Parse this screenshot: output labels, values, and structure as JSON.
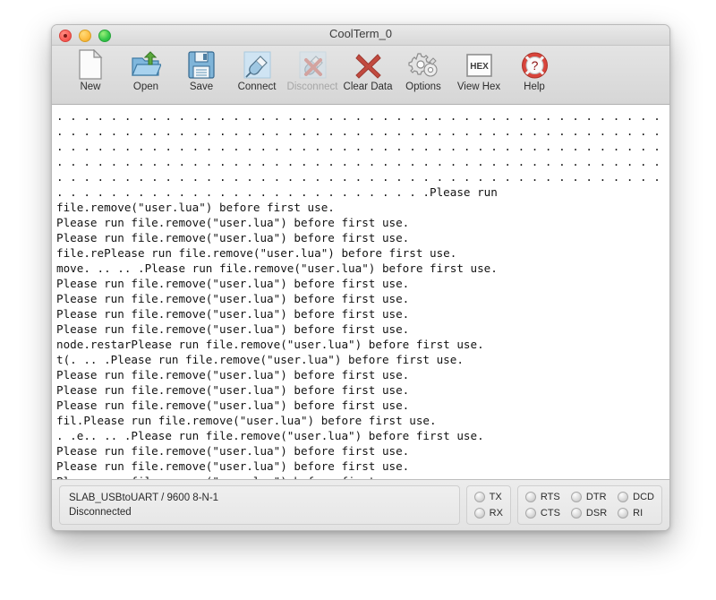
{
  "window": {
    "title": "CoolTerm_0",
    "traffic_lights": [
      "close-button",
      "minimize-button",
      "zoom-button"
    ]
  },
  "toolbar": {
    "items": [
      {
        "label": "New",
        "icon": "new-document-icon",
        "disabled": false
      },
      {
        "label": "Open",
        "icon": "open-folder-icon",
        "disabled": false
      },
      {
        "label": "Save",
        "icon": "save-floppy-icon",
        "disabled": false
      },
      {
        "label": "Connect",
        "icon": "connect-plug-icon",
        "disabled": false
      },
      {
        "label": "Disconnect",
        "icon": "disconnect-plug-icon",
        "disabled": true
      },
      {
        "label": "Clear Data",
        "icon": "clear-x-icon",
        "disabled": false
      },
      {
        "label": "Options",
        "icon": "gears-options-icon",
        "disabled": false
      },
      {
        "label": "View Hex",
        "icon": "hex-icon",
        "disabled": false,
        "icon_text": "HEX"
      },
      {
        "label": "Help",
        "icon": "help-lifering-icon",
        "disabled": false
      }
    ]
  },
  "terminal": {
    "lines": [
      ". . . . . . . . . . . . . . . . . . . . . . . . . . . . . . . . . . . . . . . . . . . . . . . . . . . . . . . . . . . . .",
      ". . . . . . . . . . . . . . . . . . . . . . . . . . . . . . . . . . . . . . . . . . . . . . . . . . . . . . . . . . . . .",
      ". . . . . . . . . . . . . . . . . . . . . . . . . . . . . . . . . . . . . . . . . . . . . . . . . . . . . . . . . . . . .",
      ". . . . . . . . . . . . . . . . . . . . . . . . . . . . . . . . . . . . . . . . . . . . . . . . . . . . . . . . . . . . .",
      ". . . . . . . . . . . . . . . . . . . . . . . . . . . . . . . . . . . . . . . . . . . . . . . . . . . . . . . . . . . . .",
      ". . . . . . . . . . . . . . . . . . . . . . . . . . . .Please run",
      "file.remove(\"user.lua\") before first use.",
      "Please run file.remove(\"user.lua\") before first use.",
      "Please run file.remove(\"user.lua\") before first use.",
      "file.rePlease run file.remove(\"user.lua\") before first use.",
      "move. .. .. .Please run file.remove(\"user.lua\") before first use.",
      "Please run file.remove(\"user.lua\") before first use.",
      "Please run file.remove(\"user.lua\") before first use.",
      "Please run file.remove(\"user.lua\") before first use.",
      "Please run file.remove(\"user.lua\") before first use.",
      "node.restarPlease run file.remove(\"user.lua\") before first use.",
      "t(. .. .Please run file.remove(\"user.lua\") before first use.",
      "Please run file.remove(\"user.lua\") before first use.",
      "Please run file.remove(\"user.lua\") before first use.",
      "Please run file.remove(\"user.lua\") before first use.",
      "fil.Please run file.remove(\"user.lua\") before first use.",
      ". .e.. .. .Please run file.remove(\"user.lua\") before first use.",
      "Please run file.remove(\"user.lua\") before first use.",
      "Please run file.remove(\"user.lua\") before first use.",
      "Please run file.remove(\"user.lua\") before first use."
    ]
  },
  "status": {
    "connection": "SLAB_USBtoUART / 9600 8-N-1",
    "state": "Disconnected",
    "led_groups": [
      {
        "name": "data-leds",
        "columns": [
          {
            "top": "TX",
            "bottom": "RX"
          }
        ]
      },
      {
        "name": "control-leds",
        "columns": [
          {
            "top": "RTS",
            "bottom": "CTS"
          },
          {
            "top": "DTR",
            "bottom": "DSR"
          },
          {
            "top": "DCD",
            "bottom": "RI"
          }
        ]
      }
    ]
  }
}
